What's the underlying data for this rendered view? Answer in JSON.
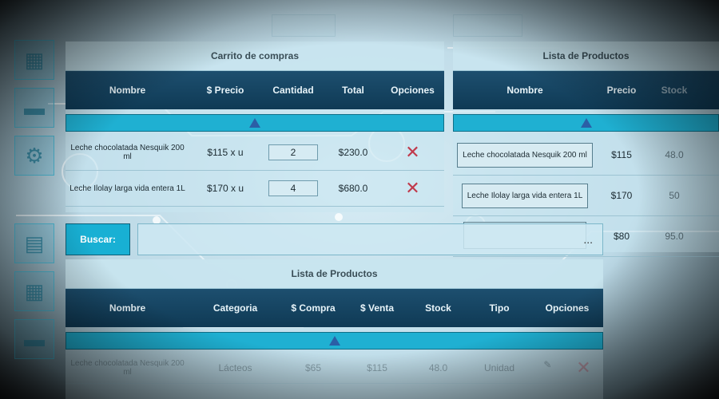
{
  "cart": {
    "title": "Carrito de compras",
    "headers": [
      "Nombre",
      "$ Precio",
      "Cantidad",
      "Total",
      "Opciones"
    ],
    "rows": [
      {
        "name": "Leche chocolatada Nesquik 200 ml",
        "price": "$115 x u",
        "qty": "2",
        "total": "$230.0"
      },
      {
        "name": "Leche Ilolay larga vida entera 1L",
        "price": "$170 x u",
        "qty": "4",
        "total": "$680.0"
      }
    ],
    "delete_glyph": "✕"
  },
  "side_list": {
    "title": "Lista de Productos",
    "headers": [
      "Nombre",
      "Precio",
      "Stock"
    ],
    "rows": [
      {
        "name": "Leche chocolatada Nesquik 200 ml",
        "price": "$115",
        "stock": "48.0"
      },
      {
        "name": "Leche Ilolay larga vida entera 1L",
        "price": "$170",
        "stock": "50"
      },
      {
        "name": "",
        "price": "$80",
        "stock": "95.0"
      }
    ]
  },
  "search": {
    "label": "Buscar:",
    "value": "...",
    "placeholder": ""
  },
  "product_list": {
    "title": "Lista de Productos",
    "headers": [
      "Nombre",
      "Categoria",
      "$ Compra",
      "$ Venta",
      "Stock",
      "Tipo",
      "Opciones"
    ],
    "rows": [
      {
        "name": "Leche chocolatada Nesquik 200 ml",
        "category": "Lácteos",
        "buy": "$65",
        "sell": "$115",
        "stock": "48.0",
        "type": "Unidad"
      }
    ]
  },
  "sidebar": {
    "icons": [
      "cash-register-icon",
      "wallet-icon",
      "gear-icon",
      "shelf-icon",
      "cash-register-icon",
      "wallet-icon"
    ]
  },
  "colors": {
    "header_bg": "#0f3a55",
    "accent": "#1fb0d2",
    "delete": "#c0394b"
  }
}
